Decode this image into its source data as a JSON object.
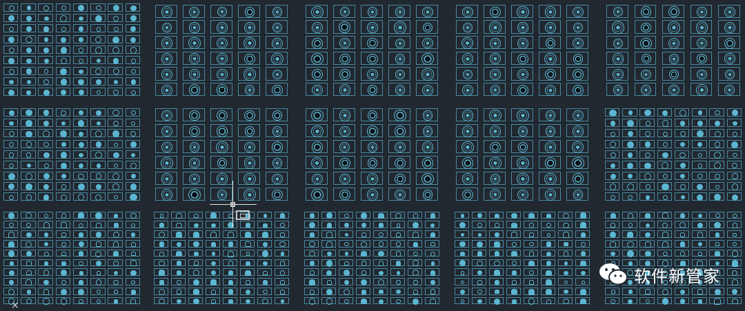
{
  "canvas": {
    "background": "#212830",
    "line_color": "#4a8aa3",
    "symbol_color": "#5cb6d1"
  },
  "watermark": {
    "icon": "wechat-logo-icon",
    "text": "软件新管家"
  },
  "cursor": {
    "icon": "crosshair-cursor-icon"
  },
  "ucs": {
    "icon": "ucs-axis-icon",
    "glyph": "×"
  }
}
